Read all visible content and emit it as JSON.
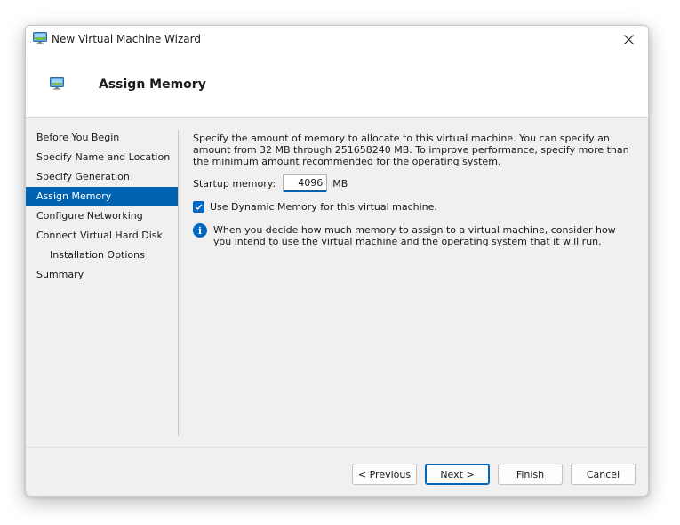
{
  "window": {
    "title": "New Virtual Machine Wizard",
    "accent": "#0063b1"
  },
  "header": {
    "title": "Assign Memory"
  },
  "sidebar": {
    "items": [
      {
        "label": "Before You Begin",
        "active": false,
        "sub": false
      },
      {
        "label": "Specify Name and Location",
        "active": false,
        "sub": false
      },
      {
        "label": "Specify Generation",
        "active": false,
        "sub": false
      },
      {
        "label": "Assign Memory",
        "active": true,
        "sub": false
      },
      {
        "label": "Configure Networking",
        "active": false,
        "sub": false
      },
      {
        "label": "Connect Virtual Hard Disk",
        "active": false,
        "sub": false
      },
      {
        "label": "Installation Options",
        "active": false,
        "sub": true
      },
      {
        "label": "Summary",
        "active": false,
        "sub": false
      }
    ]
  },
  "main": {
    "description": "Specify the amount of memory to allocate to this virtual machine. You can specify an amount from 32 MB through 251658240 MB. To improve performance, specify more than the minimum amount recommended for the operating system.",
    "startup_memory_label": "Startup memory:",
    "startup_memory_value": "4096",
    "startup_memory_unit": "MB",
    "dynamic_memory_label": "Use Dynamic Memory for this virtual machine.",
    "dynamic_memory_checked": true,
    "info_text": "When you decide how much memory to assign to a virtual machine, consider how you intend to use the virtual machine and the operating system that it will run."
  },
  "footer": {
    "previous_label": "< Previous",
    "next_label": "Next >",
    "finish_label": "Finish",
    "cancel_label": "Cancel"
  },
  "icons": {
    "title": "vm-monitor-icon",
    "header": "vm-monitor-icon",
    "close": "close-icon",
    "check": "checkmark-icon",
    "info": "info-icon"
  }
}
